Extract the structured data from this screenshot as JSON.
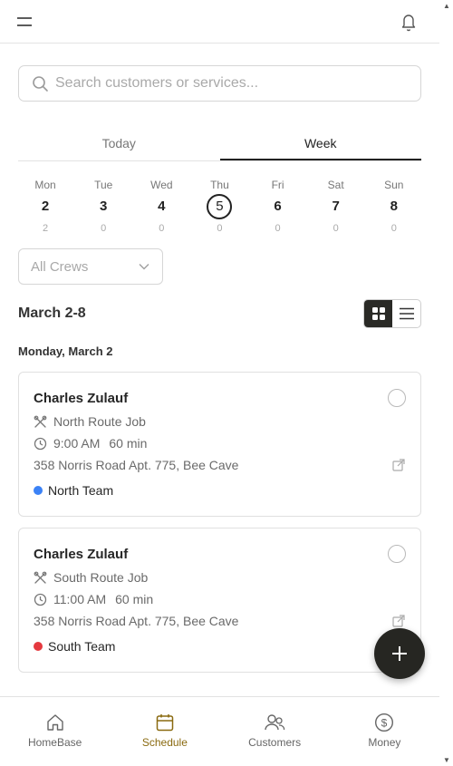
{
  "header": {
    "menu_icon": "menu-icon",
    "notification_icon": "bell-icon"
  },
  "search": {
    "placeholder": "Search customers or services..."
  },
  "tabs": [
    {
      "label": "Today",
      "active": false
    },
    {
      "label": "Week",
      "active": true
    }
  ],
  "week_days": [
    {
      "name": "Mon",
      "date": "2",
      "count": "2"
    },
    {
      "name": "Tue",
      "date": "3",
      "count": "0"
    },
    {
      "name": "Wed",
      "date": "4",
      "count": "0"
    },
    {
      "name": "Thu",
      "date": "5",
      "count": "0",
      "today": true
    },
    {
      "name": "Fri",
      "date": "6",
      "count": "0"
    },
    {
      "name": "Sat",
      "date": "7",
      "count": "0"
    },
    {
      "name": "Sun",
      "date": "8",
      "count": "0"
    }
  ],
  "filter": {
    "crews_selected": "All Crews"
  },
  "schedule": {
    "range_label": "March 2-8",
    "view_mode": "grid",
    "day_heading": "Monday, March 2",
    "jobs": [
      {
        "customer": "Charles Zulauf",
        "service": "North Route Job",
        "time": "9:00 AM",
        "duration": "60 min",
        "address": "358 Norris Road Apt. 775, Bee Cave",
        "team": "North Team",
        "team_color": "#3b82f6"
      },
      {
        "customer": "Charles Zulauf",
        "service": "South Route Job",
        "time": "11:00 AM",
        "duration": "60 min",
        "address": "358 Norris Road Apt. 775, Bee Cave",
        "team": "South Team",
        "team_color": "#e5393f"
      }
    ]
  },
  "fab": {
    "icon": "plus-icon"
  },
  "nav": [
    {
      "label": "HomeBase",
      "icon": "home-icon",
      "active": false
    },
    {
      "label": "Schedule",
      "icon": "calendar-icon",
      "active": true
    },
    {
      "label": "Customers",
      "icon": "users-icon",
      "active": false
    },
    {
      "label": "Money",
      "icon": "dollar-icon",
      "active": false
    }
  ],
  "colors": {
    "accent": "#8a6a10",
    "dark": "#262622"
  }
}
